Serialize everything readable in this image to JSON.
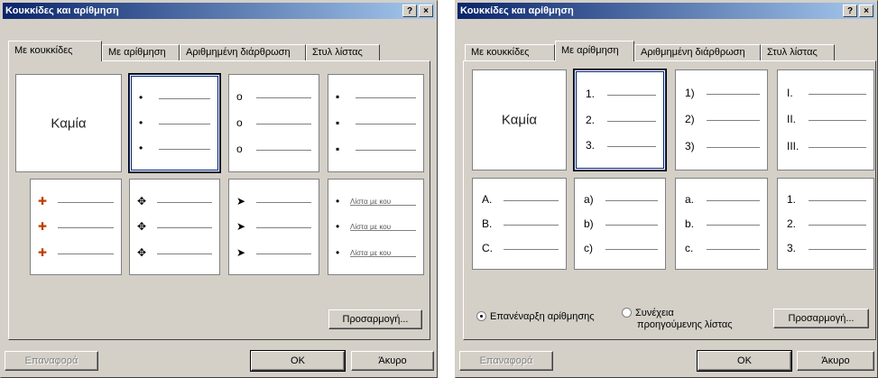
{
  "left_dialog": {
    "title": "Κουκκίδες και αρίθμηση",
    "help_btn": "?",
    "close_btn": "×",
    "tabs": [
      "Με κουκκίδες",
      "Με αρίθμηση",
      "Αριθμημένη διάρθρωση",
      "Στυλ λίστας"
    ],
    "active_tab": "Με κουκκίδες",
    "none_label": "Καμία",
    "bullet_sets": [
      [
        "•",
        "•",
        "•"
      ],
      [
        "o",
        "o",
        "o"
      ],
      [
        "▪",
        "▪",
        "▪"
      ],
      [
        "✚",
        "✚",
        "✚"
      ],
      [
        "✥",
        "✥",
        "✥"
      ],
      [
        "➤",
        "➤",
        "➤"
      ],
      [
        "•",
        "•",
        "•"
      ]
    ],
    "list_sample_text": "Λίστα με κου",
    "customize_btn": "Προσαρμογή...",
    "reset_btn": "Επαναφορά",
    "ok_btn": "OK",
    "cancel_btn": "Άκυρο"
  },
  "right_dialog": {
    "title": "Κουκκίδες και αρίθμηση",
    "help_btn": "?",
    "close_btn": "×",
    "tabs": [
      "Με κουκκίδες",
      "Με αρίθμηση",
      "Αριθμημένη διάρθρωση",
      "Στυλ λίστας"
    ],
    "active_tab": "Με αρίθμηση",
    "none_label": "Καμία",
    "number_sets": [
      [
        "1.",
        "2.",
        "3."
      ],
      [
        "1)",
        "2)",
        "3)"
      ],
      [
        "I.",
        "II.",
        "III."
      ],
      [
        "A.",
        "B.",
        "C."
      ],
      [
        "a)",
        "b)",
        "c)"
      ],
      [
        "a.",
        "b.",
        "c."
      ],
      [
        "1.",
        "2.",
        "3."
      ]
    ],
    "restart_label": "Επανέναρξη αρίθμησης",
    "continue_label_1": "Συνέχεια",
    "continue_label_2": "προηγούμενης λίστας",
    "customize_btn": "Προσαρμογή...",
    "reset_btn": "Επαναφορά",
    "ok_btn": "OK",
    "cancel_btn": "Άκυρο"
  },
  "colors": {
    "dialog_bg": "#d4d0c8",
    "title_start": "#0a246a",
    "title_end": "#a6caf0"
  }
}
